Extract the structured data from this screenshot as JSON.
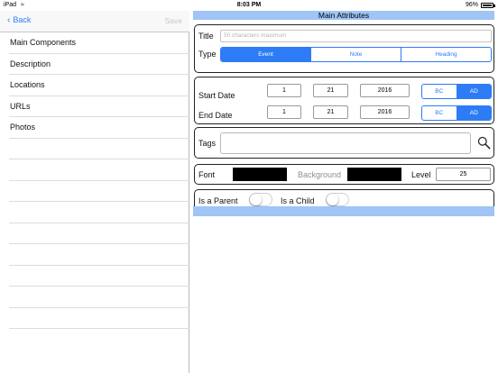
{
  "status_bar": {
    "carrier": "iPad",
    "time": "8:03 PM",
    "battery": "96%"
  },
  "master": {
    "back_label": "Back",
    "save_label": "Save",
    "items": [
      {
        "label": "Main Components"
      },
      {
        "label": "Description"
      },
      {
        "label": "Locations"
      },
      {
        "label": "URLs"
      },
      {
        "label": "Photos"
      },
      {
        "label": ""
      },
      {
        "label": ""
      },
      {
        "label": ""
      },
      {
        "label": ""
      },
      {
        "label": ""
      },
      {
        "label": ""
      },
      {
        "label": ""
      },
      {
        "label": ""
      },
      {
        "label": ""
      },
      {
        "label": ""
      }
    ]
  },
  "detail": {
    "header": "Main Attributes",
    "title_label": "Title",
    "title_placeholder": "50 characters maximum",
    "type_label": "Type",
    "type_options": [
      "Event",
      "Note",
      "Heading"
    ],
    "type_selected": "Event",
    "start_label": "Start Date",
    "start": {
      "month": "1",
      "day": "21",
      "year": "2016"
    },
    "end_label": "End Date",
    "end": {
      "month": "1",
      "day": "21",
      "year": "2016"
    },
    "era_options": [
      "BC",
      "AD"
    ],
    "era_selected": "AD",
    "tags_label": "Tags",
    "font_label": "Font",
    "background_label": "Background",
    "level_label": "Level",
    "level_value": "25",
    "parent_label": "Is a Parent",
    "child_label": "Is a Child",
    "is_parent": false,
    "is_child": false
  },
  "colors": {
    "accent": "#2d7cf6",
    "header_bar": "#9fc4f5",
    "font_color": "#000000",
    "background_color": "#000000"
  }
}
